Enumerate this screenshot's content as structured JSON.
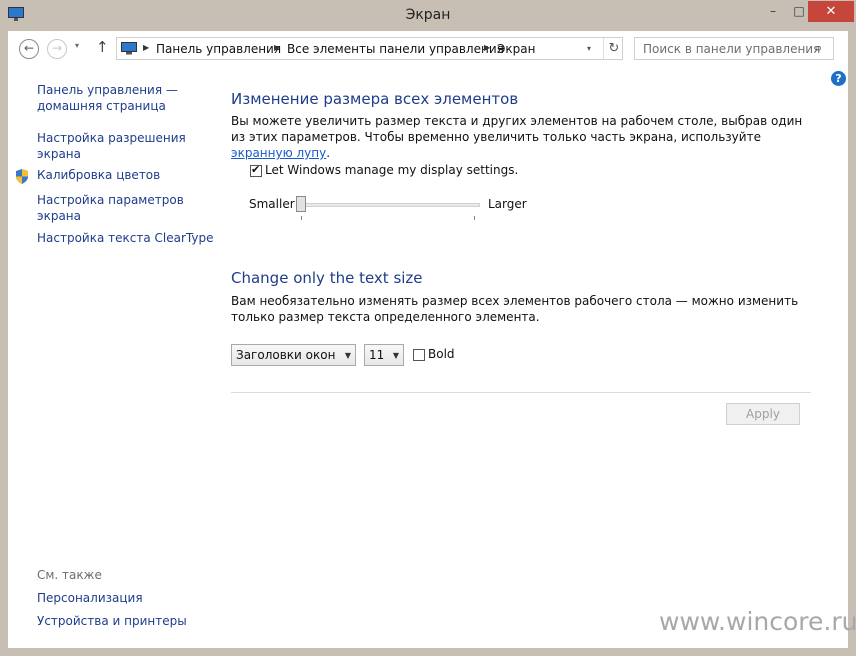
{
  "window": {
    "title": "Экран"
  },
  "titlebar": {
    "min": "–",
    "max": "□",
    "close": "✕"
  },
  "addressbar": {
    "back_icon": "←",
    "forward_icon": "→",
    "recent_icon": "▾",
    "up_icon": "↑",
    "crumbs": [
      "Панель управления",
      "Все элементы панели управления",
      "Экран"
    ],
    "separator": "▶",
    "dropdown_icon": "▾",
    "refresh_icon": "↻",
    "search_placeholder": "Поиск в панели управления",
    "search_icon": "⌕"
  },
  "help": {
    "icon": "?"
  },
  "sidebar": {
    "items": [
      {
        "label": "Панель управления —\nдомашняя страница"
      },
      {
        "label": "Настройка разрешения\nэкрана"
      },
      {
        "label": "Калибровка цветов",
        "icon": "shield-icon"
      },
      {
        "label": "Настройка параметров\nэкрана"
      },
      {
        "label": "Настройка текста ClearType"
      }
    ],
    "see_also": "См. также",
    "see_also_items": [
      {
        "label": "Персонализация"
      },
      {
        "label": "Устройства и принтеры"
      }
    ]
  },
  "main": {
    "section1": {
      "heading": "Изменение размера всех элементов",
      "text_before_link": "Вы можете увеличить размер текста и других элементов на рабочем столе, выбрав один из этих параметров. Чтобы временно увеличить только часть экрана, используйте ",
      "link": "экранную лупу",
      "text_after_link": ".",
      "checkbox_label": "Let Windows manage my display settings.",
      "checkbox_checked": true,
      "slider_min_label": "Smaller",
      "slider_max_label": "Larger",
      "slider_level": 0
    },
    "section2": {
      "heading": "Change only the text size",
      "text": "Вам необязательно изменять размер всех элементов рабочего стола — можно изменить только размер текста определенного элемента.",
      "element_select": "Заголовки окон",
      "size_select": "11",
      "bold_label": "Bold",
      "bold_checked": false
    },
    "apply_label": "Apply"
  },
  "watermark": "www.wincore.ru",
  "colors": {
    "link": "#1e3d8a",
    "titlebar": "#c7bfb3",
    "close": "#c7463b",
    "help": "#1e6fc6"
  }
}
